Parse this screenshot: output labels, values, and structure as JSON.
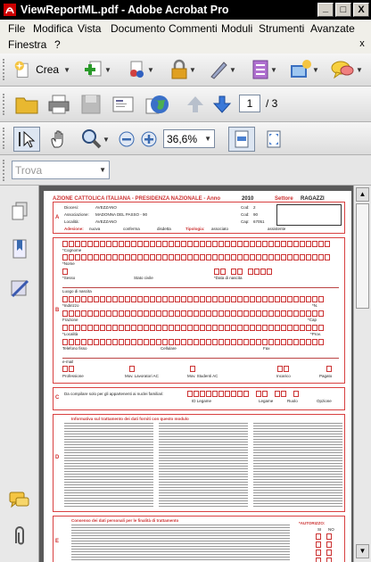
{
  "window": {
    "title": "ViewReportML.pdf - Adobe Acrobat Pro",
    "buttons": [
      "_",
      "□",
      "X"
    ]
  },
  "menubar": {
    "items": [
      "File",
      "Modifica",
      "Vista",
      "Documento",
      "Commenti",
      "Moduli",
      "Strumenti",
      "Avanzate",
      "Finestra",
      "?"
    ],
    "close": "x"
  },
  "toolbar1": {
    "create_label": "Crea"
  },
  "toolbar2": {
    "page_current": "1",
    "page_total": "/ 3"
  },
  "toolbar3": {
    "zoom": "36,6%"
  },
  "find": {
    "placeholder": "Trova"
  },
  "document": {
    "header_left": "AZIONE CATTOLICA ITALIANA - PRESIDENZA NAZIONALE - Anno",
    "header_year": "2010",
    "header_sector_label": "Settore",
    "header_sector": "RAGAZZI",
    "diocese_label": "Diocesi:",
    "diocese": "AVEZZANO",
    "association_label": "Associazione:",
    "association": "MADONNA DEL PASSO - 90",
    "locality_label": "Località:",
    "locality": "AVEZZANO",
    "cod_label": "Cod:",
    "cod1": "2",
    "cod2": "90",
    "cap_label": "Cap:",
    "cap": "67051",
    "adesione_label": "Adesione:",
    "adesione_items": [
      "nuova",
      "conferma",
      "disdetta",
      "Tipologia:",
      "associato",
      "assistente"
    ],
    "section_letters": [
      "A",
      "B",
      "C",
      "D",
      "E"
    ],
    "b_fields": [
      "*Cognome",
      "*Nome",
      "*Sesso",
      "Stato civile",
      "*Data di nascita",
      "Luogo di nascita",
      "*Indirizzo",
      "*N.",
      "Frazione",
      "*Cap",
      "*Località",
      "*Prov.",
      "Telefono fisso",
      "Cellulare",
      "Fax",
      "e-mail",
      "Professione",
      "Mov. Lavoratori AC",
      "Mov. Studenti AC",
      "Incarico",
      "Pagato"
    ],
    "c_text": "Da compilare solo per gli appartenenti ai nuclei familiari:",
    "c_fields": [
      "ID Legame",
      "Legame",
      "Ruolo",
      "Opzione"
    ],
    "d_title": "Informativa sul trattamento dei dati forniti con questo modulo",
    "e_title": "Consenso dei dati personali per le finalità di trattamento",
    "e_authorize": "*AUTORIZZO:",
    "e_options": [
      "SI",
      "NO"
    ]
  }
}
